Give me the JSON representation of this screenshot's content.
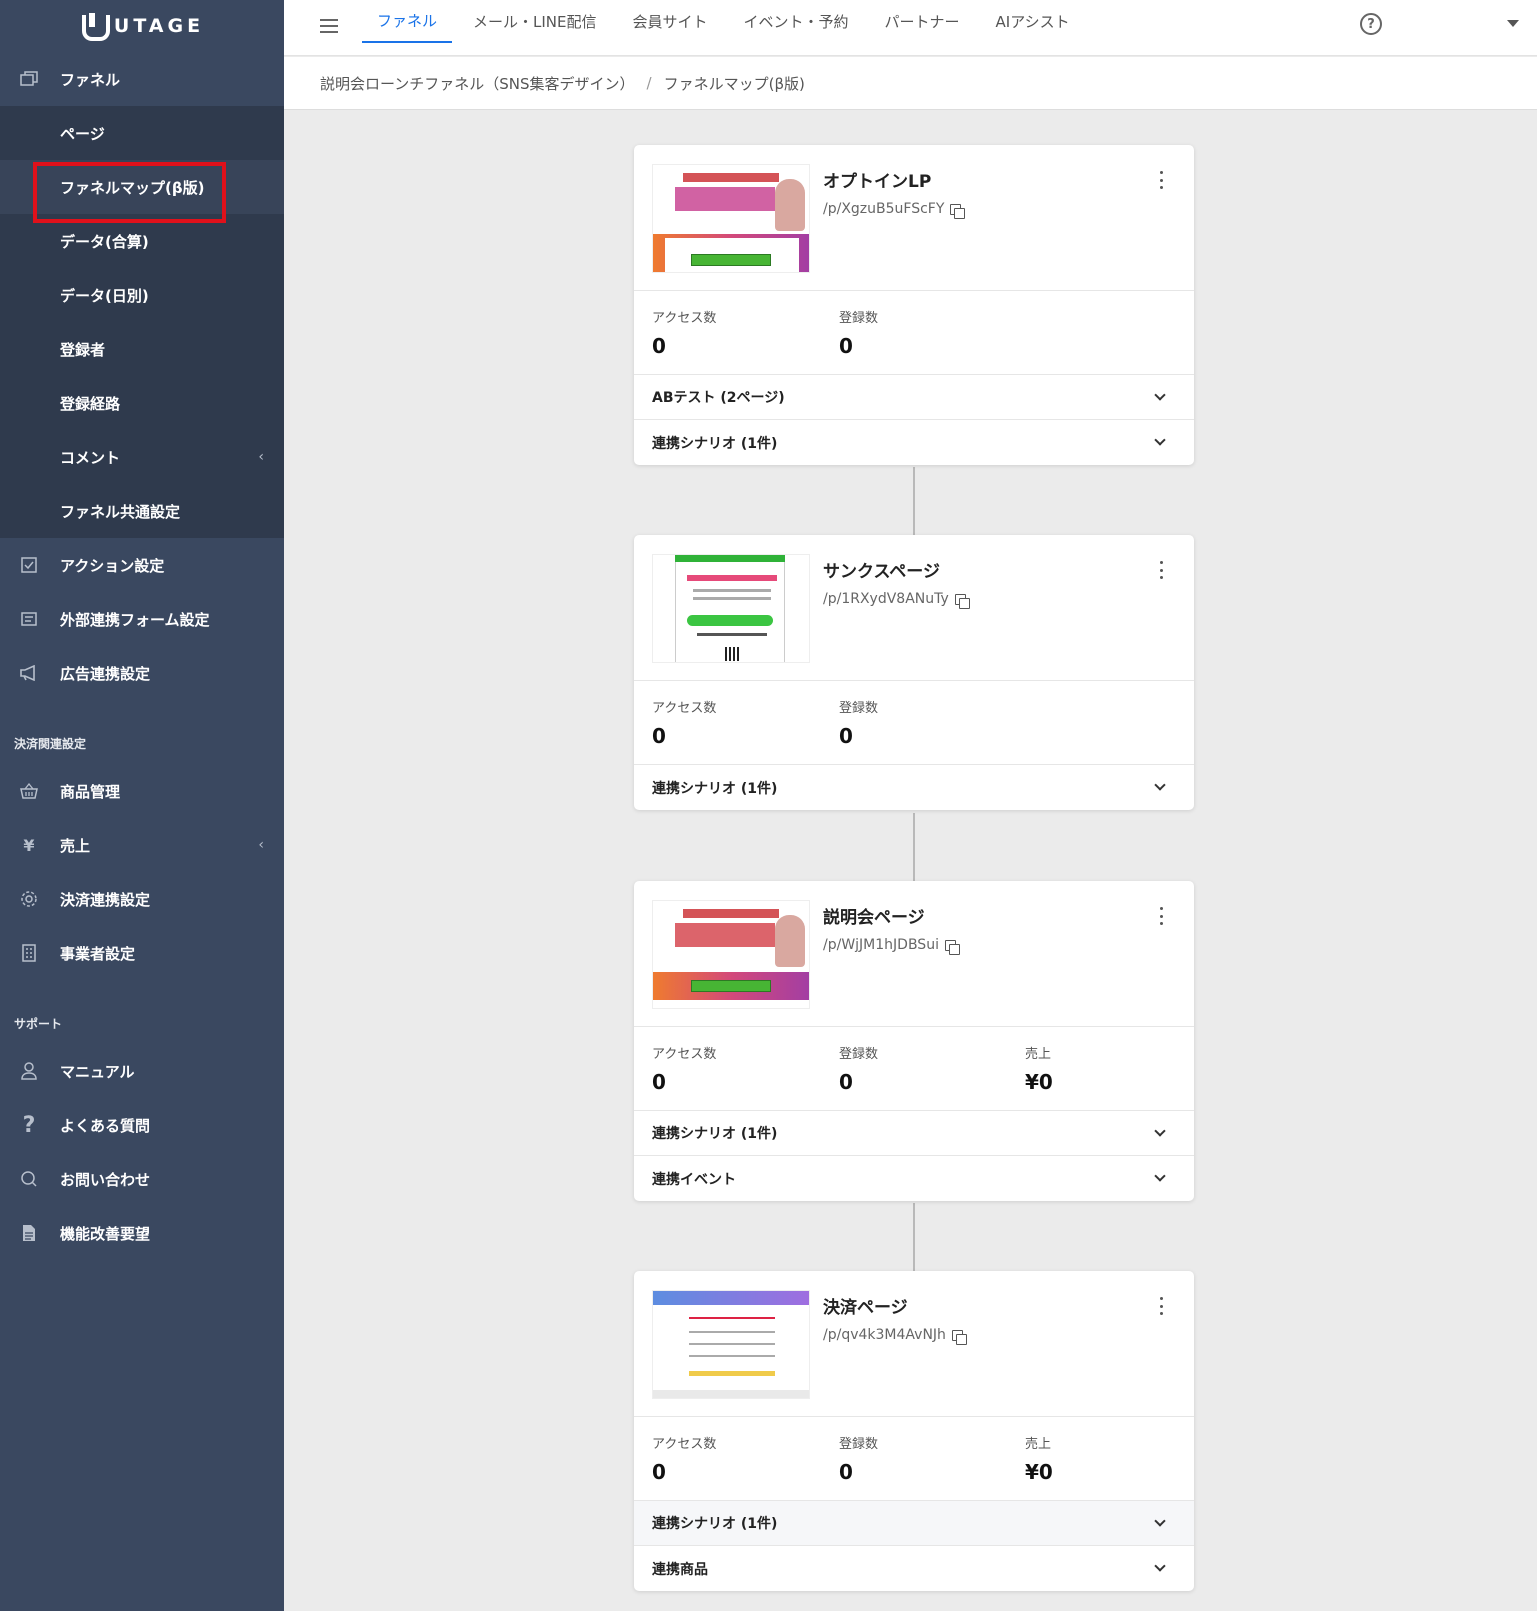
{
  "app": {
    "brand": "UTAGE"
  },
  "sidebar": {
    "funnel": {
      "label": "ファネル",
      "icon": "window-stack-icon"
    },
    "sub_items": [
      {
        "label": "ページ"
      },
      {
        "label": "ファネルマップ(β版)",
        "active": true
      },
      {
        "label": "データ(合算)"
      },
      {
        "label": "データ(日別)"
      },
      {
        "label": "登録者"
      },
      {
        "label": "登録経路"
      },
      {
        "label": "コメント",
        "caret": "‹"
      },
      {
        "label": "ファネル共通設定"
      }
    ],
    "main_items": [
      {
        "label": "アクション設定",
        "icon": "checklist-icon"
      },
      {
        "label": "外部連携フォーム設定",
        "icon": "form-icon"
      },
      {
        "label": "広告連携設定",
        "icon": "megaphone-icon"
      }
    ],
    "payment_section": {
      "title": "決済関連設定",
      "items": [
        {
          "label": "商品管理",
          "icon": "basket-icon"
        },
        {
          "label": "売上",
          "icon": "yen-icon",
          "glyph": "¥",
          "caret": "‹"
        },
        {
          "label": "決済連携設定",
          "icon": "gear-icon"
        },
        {
          "label": "事業者設定",
          "icon": "building-icon"
        }
      ]
    },
    "support_section": {
      "title": "サポート",
      "items": [
        {
          "label": "マニュアル",
          "icon": "person-icon"
        },
        {
          "label": "よくある質問",
          "icon": "question-icon",
          "glyph": "?"
        },
        {
          "label": "お問い合わせ",
          "icon": "chat-icon"
        },
        {
          "label": "機能改善要望",
          "icon": "document-icon"
        }
      ]
    }
  },
  "topbar": {
    "tabs": [
      {
        "label": "ファネル",
        "active": true
      },
      {
        "label": "メール・LINE配信"
      },
      {
        "label": "会員サイト"
      },
      {
        "label": "イベント・予約"
      },
      {
        "label": "パートナー"
      },
      {
        "label": "AIアシスト"
      }
    ],
    "help_glyph": "?"
  },
  "breadcrumb": {
    "parent": "説明会ローンチファネル（SNS集客デザイン）",
    "separator": "/",
    "current": "ファネルマップ(β版)"
  },
  "cards": [
    {
      "title": "オプトインLP",
      "path": "/p/XgzuB5uFScFY",
      "stats": [
        {
          "label": "アクセス数",
          "value": "0"
        },
        {
          "label": "登録数",
          "value": "0"
        }
      ],
      "accordions": [
        {
          "label": "ABテスト (2ページ)"
        },
        {
          "label": "連携シナリオ (1件)"
        }
      ]
    },
    {
      "title": "サンクスページ",
      "path": "/p/1RXydV8ANuTy",
      "stats": [
        {
          "label": "アクセス数",
          "value": "0"
        },
        {
          "label": "登録数",
          "value": "0"
        }
      ],
      "accordions": [
        {
          "label": "連携シナリオ (1件)"
        }
      ]
    },
    {
      "title": "説明会ページ",
      "path": "/p/WjJM1hJDBSui",
      "stats": [
        {
          "label": "アクセス数",
          "value": "0"
        },
        {
          "label": "登録数",
          "value": "0"
        },
        {
          "label": "売上",
          "value": "¥0"
        }
      ],
      "accordions": [
        {
          "label": "連携シナリオ (1件)"
        },
        {
          "label": "連携イベント"
        }
      ]
    },
    {
      "title": "決済ページ",
      "path": "/p/qv4k3M4AvNJh",
      "stats": [
        {
          "label": "アクセス数",
          "value": "0"
        },
        {
          "label": "登録数",
          "value": "0"
        },
        {
          "label": "売上",
          "value": "¥0"
        }
      ],
      "accordions": [
        {
          "label": "連携シナリオ (1件)"
        },
        {
          "label": "連携商品"
        }
      ]
    }
  ]
}
